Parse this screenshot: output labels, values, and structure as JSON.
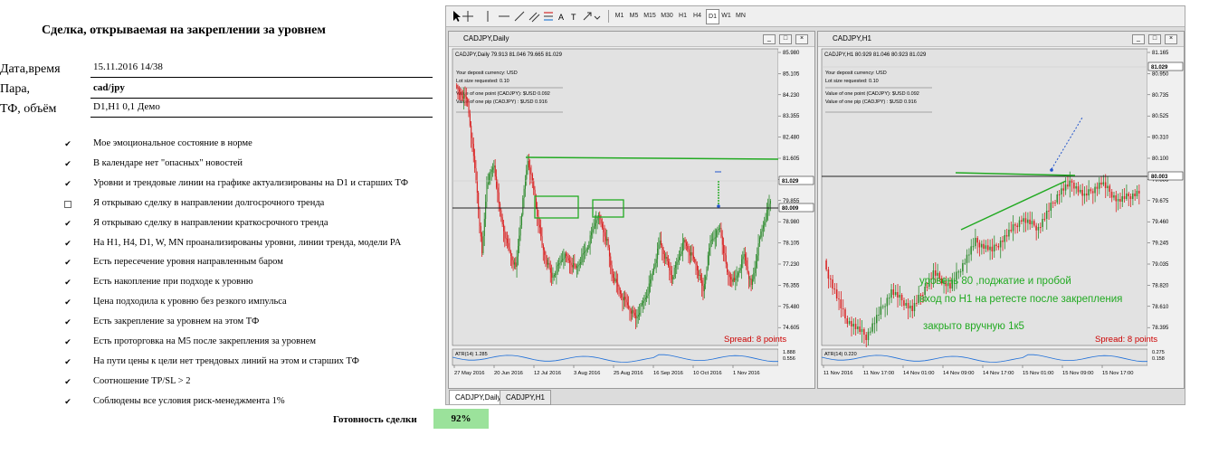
{
  "doc": {
    "title": "Сделка, открываемая на закреплении за уровнем",
    "fields": [
      {
        "label": "Дата,время",
        "value": "15.11.2016  14/38"
      },
      {
        "label": "Пара,",
        "value": "cad/jpy"
      },
      {
        "label": "ТФ, объём",
        "value": "D1,H1  0,1 Демо"
      }
    ],
    "checklist": [
      {
        "text": "Мое эмоциональное состояние в норме",
        "checked": true
      },
      {
        "text": "В календаре нет \"опасных\" новостей",
        "checked": true
      },
      {
        "text": "Уровни и трендовые линии на графике актуализированы на  D1 и старших ТФ",
        "checked": true
      },
      {
        "text": "Я открываю сделку в направлении долгосрочного тренда",
        "checked": false
      },
      {
        "text": "Я открываю сделку в направлении краткосрочного тренда",
        "checked": true
      },
      {
        "text": "На H1, H4, D1, W, MN проанализированы уровни, линии тренда, модели PA",
        "checked": true
      },
      {
        "text": "Есть пересечение уровня направленным баром",
        "checked": true
      },
      {
        "text": "Есть накопление при подходе к уровню",
        "checked": true
      },
      {
        "text": "Цена подходила к уровню без резкого импульса",
        "checked": true
      },
      {
        "text": "Есть закрепление за уровнем на этом ТФ",
        "checked": true
      },
      {
        "text": "Есть проторговка на М5 после закрепления за уровнем",
        "checked": true
      },
      {
        "text": "На пути цены к цели нет трендовых линий на этом и старших ТФ",
        "checked": true
      },
      {
        "text": "Соотношение TP/SL > 2",
        "checked": true
      },
      {
        "text": "Соблюдены все условия риск-менеджмента 1%",
        "checked": true
      }
    ],
    "check_mark": "✔",
    "readiness_label": "Готовность сделки",
    "readiness_value": "92%"
  },
  "terminal": {
    "timeframes": [
      "M1",
      "M5",
      "M15",
      "M30",
      "H1",
      "H4",
      "D1",
      "W1",
      "MN"
    ],
    "active_timeframe": "D1",
    "tools": [
      "cursor-icon",
      "crosshair-icon",
      "vertical-line-icon",
      "horizontal-line-icon",
      "trendline-icon",
      "channel-icon",
      "fibonacci-icon",
      "text-icon",
      "label-icon",
      "arrow-icon"
    ],
    "tool_glyphs": {
      "text": "A",
      "label": "T"
    },
    "tabs": [
      "CADJPY,Daily",
      "CADJPY,H1"
    ],
    "active_tab": "CADJPY,Daily",
    "daily": {
      "window_title": "CADJPY,Daily",
      "ohlc": "CADJPY,Daily  79.913 81.046 79.665 81.029",
      "info": [
        "Your deposit currency: USD",
        "Lot size requested: 0.10",
        "Value of one point (CADJPY):  $USD 0.092",
        "Value of one pip    (CADJPY) : $USD 0.916"
      ],
      "price_labels": [
        "85.980",
        "85.105",
        "84.230",
        "83.355",
        "82.480",
        "81.605",
        "80.730",
        "79.855",
        "78.980",
        "78.105",
        "77.230",
        "76.355",
        "75.480",
        "74.605"
      ],
      "current_price": "81.029",
      "level_price": "80.009",
      "spread": "Spread: 8 points",
      "atr_label": "ATR(14) 1.285",
      "atr_levels": [
        "1.888",
        "0.556"
      ],
      "dates": [
        "27 May 2016",
        "20 Jun 2016",
        "12 Jul 2016",
        "3 Aug 2016",
        "25 Aug 2016",
        "16 Sep 2016",
        "10 Oct 2016",
        "1 Nov 2016"
      ]
    },
    "h1": {
      "window_title": "CADJPY,H1",
      "ohlc": "CADJPY,H1  80.929 81.046 80.923 81.029",
      "info": [
        "Your deposit currency: USD",
        "Lot size requested: 0.10",
        "Value of one point (CADJPY):  $USD 0.092",
        "Value of one pip    (CADJPY) : $USD 0.916"
      ],
      "price_labels": [
        "81.165",
        "80.950",
        "80.735",
        "80.525",
        "80.310",
        "80.100",
        "79.885",
        "79.675",
        "79.460",
        "79.245",
        "79.035",
        "78.820",
        "78.610",
        "78.395"
      ],
      "current_price": "81.029",
      "level_price": "80.003",
      "spread": "Spread: 8 points",
      "atr_label": "ATR(14) 0.220",
      "atr_levels": [
        "0.275",
        "0.158"
      ],
      "dates": [
        "11 Nov 2016",
        "11 Nov 17:00",
        "14 Nov 01:00",
        "14 Nov 09:00",
        "14 Nov 17:00",
        "15 Nov 01:00",
        "15 Nov 09:00",
        "15 Nov 17:00"
      ],
      "annotations": [
        "уровень 80    ,поджатие и пробой",
        "вход по H1 на ретесте после закрепления",
        "закрыто вручную 1к5"
      ]
    },
    "colors": {
      "bull": "#2e8b2e",
      "bear": "#d92020",
      "annotation": "#22aa22",
      "spread": "#cc0000"
    }
  }
}
